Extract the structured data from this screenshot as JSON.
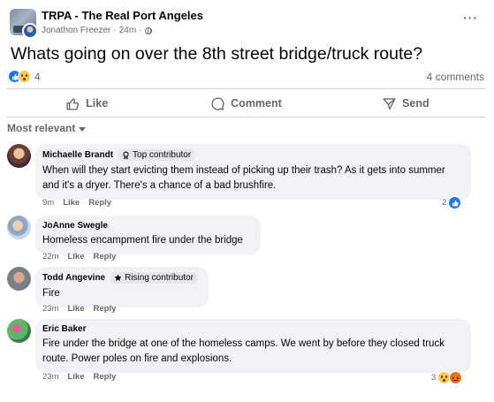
{
  "post": {
    "group_name": "TRPA - The Real Port Angeles",
    "author": "Jonathon Freezer",
    "time": "24m",
    "separator": "·",
    "more_label": "···",
    "text": "Whats going on over the 8th street bridge/truck route?",
    "reaction_count": "4",
    "comment_count": "4 comments"
  },
  "actions": {
    "like": "Like",
    "comment": "Comment",
    "send": "Send"
  },
  "sort_label": "Most relevant",
  "comments": [
    {
      "name": "Michaelle Brandt",
      "badge": "Top contributor",
      "text": "When will they start evicting them instead of picking up their trash? As it gets into summer and it's a dryer. There's a chance of a bad brushfire.",
      "time": "9m",
      "like": "Like",
      "reply": "Reply",
      "reaction_count": "2"
    },
    {
      "name": "JoAnne Swegle",
      "text": "Homeless encampment fire under the bridge",
      "time": "22m",
      "like": "Like",
      "reply": "Reply"
    },
    {
      "name": "Todd Angevine",
      "badge": "Rising contributor",
      "text": "Fire",
      "time": "23m",
      "like": "Like",
      "reply": "Reply"
    },
    {
      "name": "Eric Baker",
      "text": "Fire under the bridge at one of the homeless camps. We went by before they closed truck route. Power poles on fire and explosions.",
      "time": "23m",
      "like": "Like",
      "reply": "Reply",
      "reaction_count": "3"
    }
  ],
  "colors": {
    "accent": "#1877f2",
    "bubble": "#f0f2f5",
    "secondary_text": "#65676b"
  }
}
